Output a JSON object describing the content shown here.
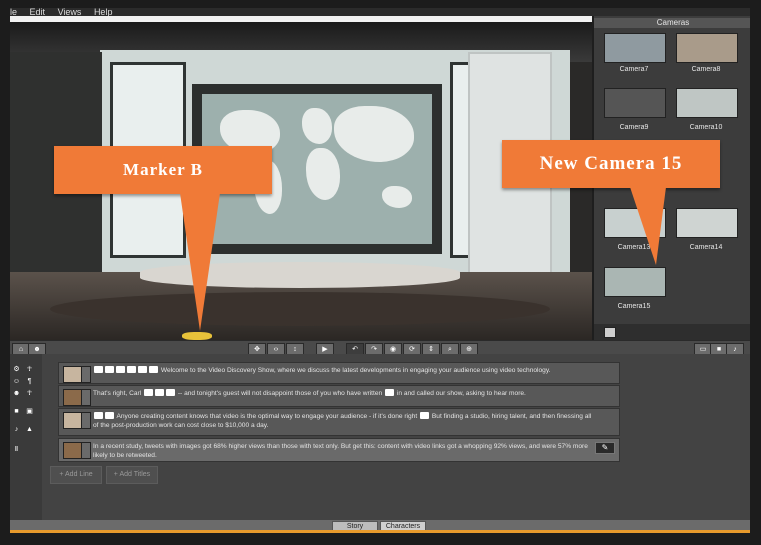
{
  "menu": [
    "le",
    "Edit",
    "Views",
    "Help"
  ],
  "cameras_panel": {
    "title": "Cameras",
    "items": [
      {
        "label": "Camera7"
      },
      {
        "label": "Camera8"
      },
      {
        "label": "Camera9"
      },
      {
        "label": "Camera10"
      },
      {
        "label": "Camera13"
      },
      {
        "label": "Camera14"
      },
      {
        "label": "Camera15"
      }
    ]
  },
  "callouts": {
    "marker": "Marker B",
    "camera": "New Camera 15"
  },
  "story": {
    "lines": [
      {
        "text_a": "Welcome to the Video Discovery Show, where we discuss the latest developments in engaging your audience using video technology.",
        "text_b": ""
      },
      {
        "text_a": "That's right, Carl",
        "text_b": "-- and tonight's guest will not disappoint those of you who have written",
        "text_c": "in and called our show, asking to hear more."
      },
      {
        "text_a": "Anyone creating content knows that video is the optimal way to engage your audience - if it's done right",
        "text_b": "But finding a studio, hiring talent, and then finessing all of the post-production work can cost close to $10,000 a day."
      },
      {
        "text_a": "In a recent study, tweets with images got 68% higher views than those with text only. But get this: content with video links got a whopping 92% views, and were 57% more likely to be retweeted."
      }
    ],
    "add_line": "+ Add Line",
    "add_titles": "+ Add Titles"
  },
  "tabs": {
    "story": "Story",
    "characters": "Characters"
  },
  "colors": {
    "callout": "#f07a37",
    "accent_bar": "#e79a2c"
  }
}
